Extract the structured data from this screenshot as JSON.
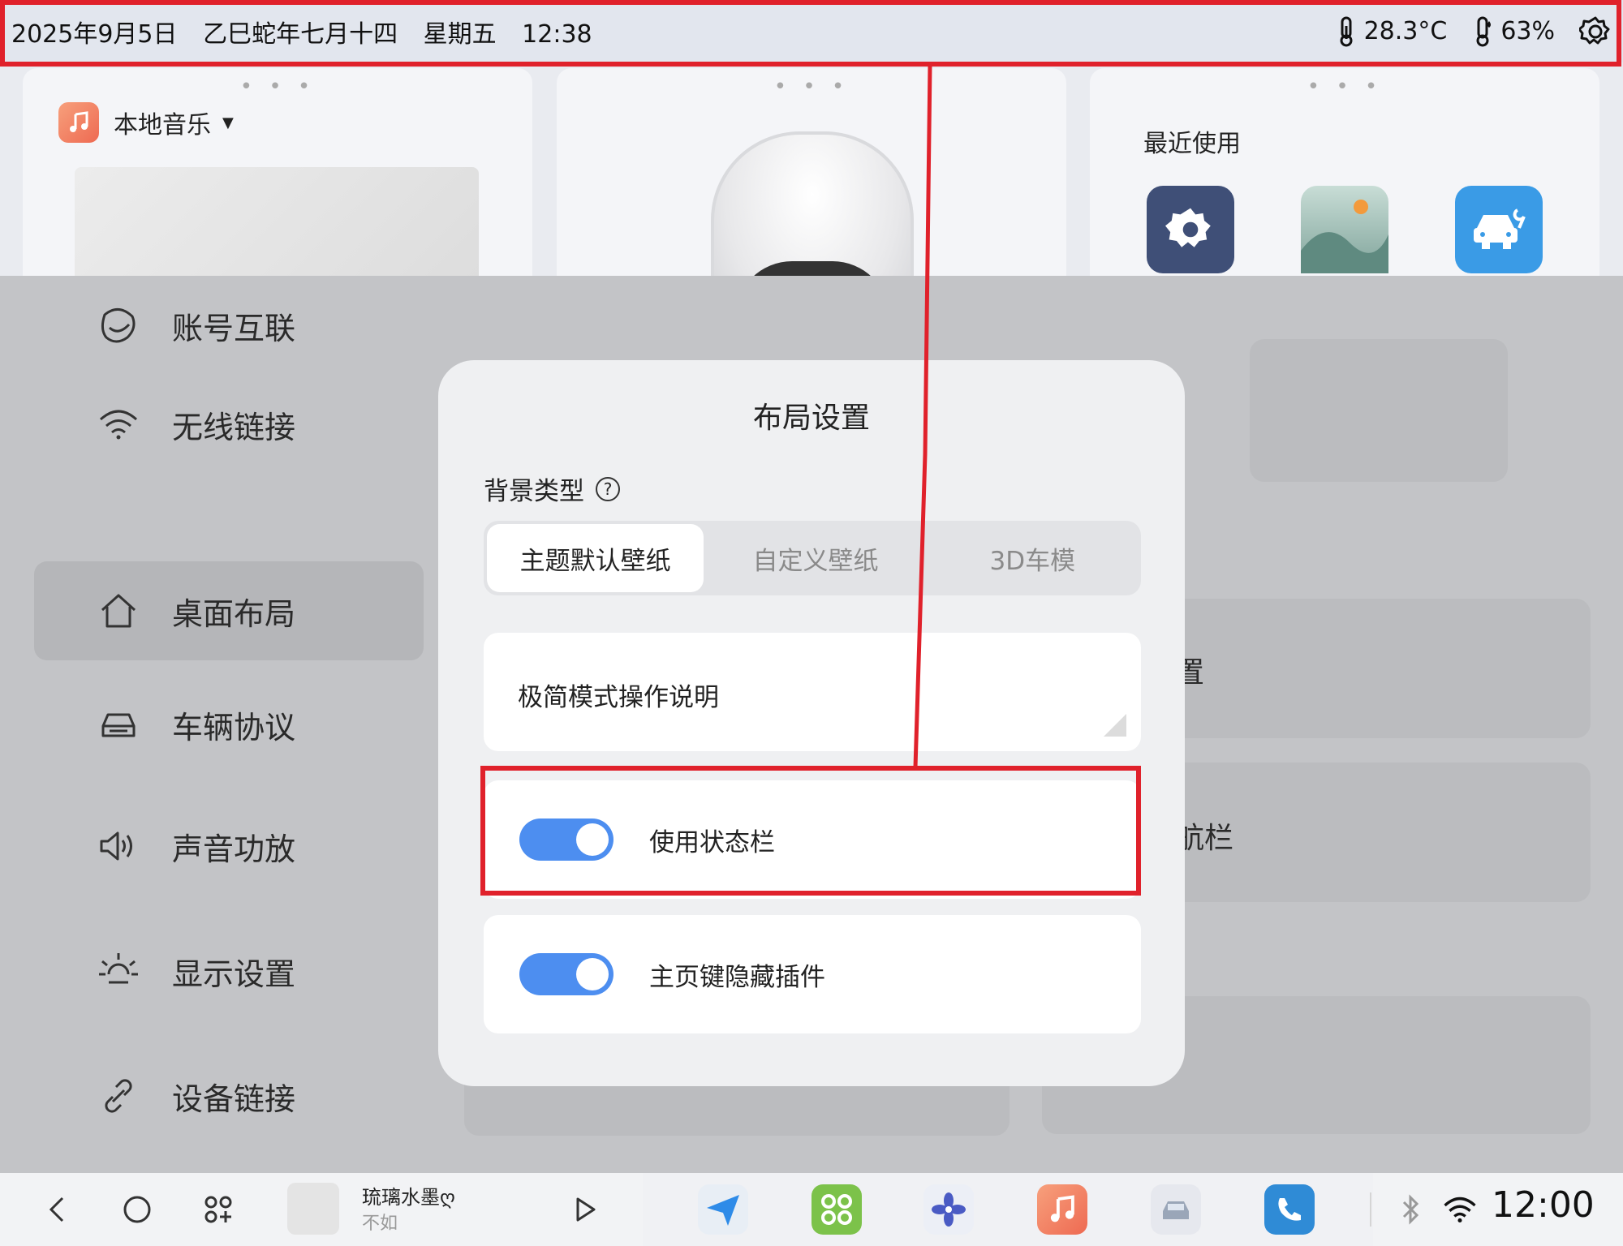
{
  "status_bar": {
    "date": "2025年9月5日",
    "lunar": "乙巳蛇年七月十四",
    "weekday": "星期五",
    "time": "12:38",
    "temperature": "28.3°C",
    "humidity": "63%"
  },
  "widgets": {
    "music": {
      "source_label": "本地音乐"
    },
    "recent": {
      "title": "最近使用",
      "apps": [
        {
          "icon": "settings-gear-icon",
          "color": "#3f4f77"
        },
        {
          "icon": "gallery-icon",
          "color": "#7fa39a"
        },
        {
          "icon": "car-service-icon",
          "color": "#3a9be6"
        }
      ]
    }
  },
  "settings_menu": {
    "items": [
      {
        "label": "账号互联",
        "icon": "account-link-icon"
      },
      {
        "label": "无线链接",
        "icon": "wifi-icon"
      },
      {
        "label": "桌面布局",
        "icon": "home-icon",
        "active": true
      },
      {
        "label": "车辆协议",
        "icon": "car-icon"
      },
      {
        "label": "声音功放",
        "icon": "speaker-icon"
      },
      {
        "label": "显示设置",
        "icon": "brightness-icon"
      },
      {
        "label": "设备链接",
        "icon": "link-icon"
      }
    ]
  },
  "background_panels": {
    "panel_a_text": "置",
    "panel_b_text": "航栏"
  },
  "dialog": {
    "title": "布局设置",
    "background_type_label": "背景类型",
    "help_glyph": "?",
    "segments": [
      {
        "label": "主题默认壁纸",
        "selected": true
      },
      {
        "label": "自定义壁纸",
        "selected": false
      },
      {
        "label": "3D车模",
        "selected": false
      }
    ],
    "doc_card_label": "极简模式操作说明",
    "toggles": [
      {
        "label": "使用状态栏",
        "on": true
      },
      {
        "label": "主页键隐藏插件",
        "on": true
      }
    ]
  },
  "dock": {
    "song_title": "琉璃水墨ღ",
    "artist": "不如",
    "clock": "12:00",
    "accent_color": "#4d8ef0",
    "highlight_color": "#e0212b"
  }
}
